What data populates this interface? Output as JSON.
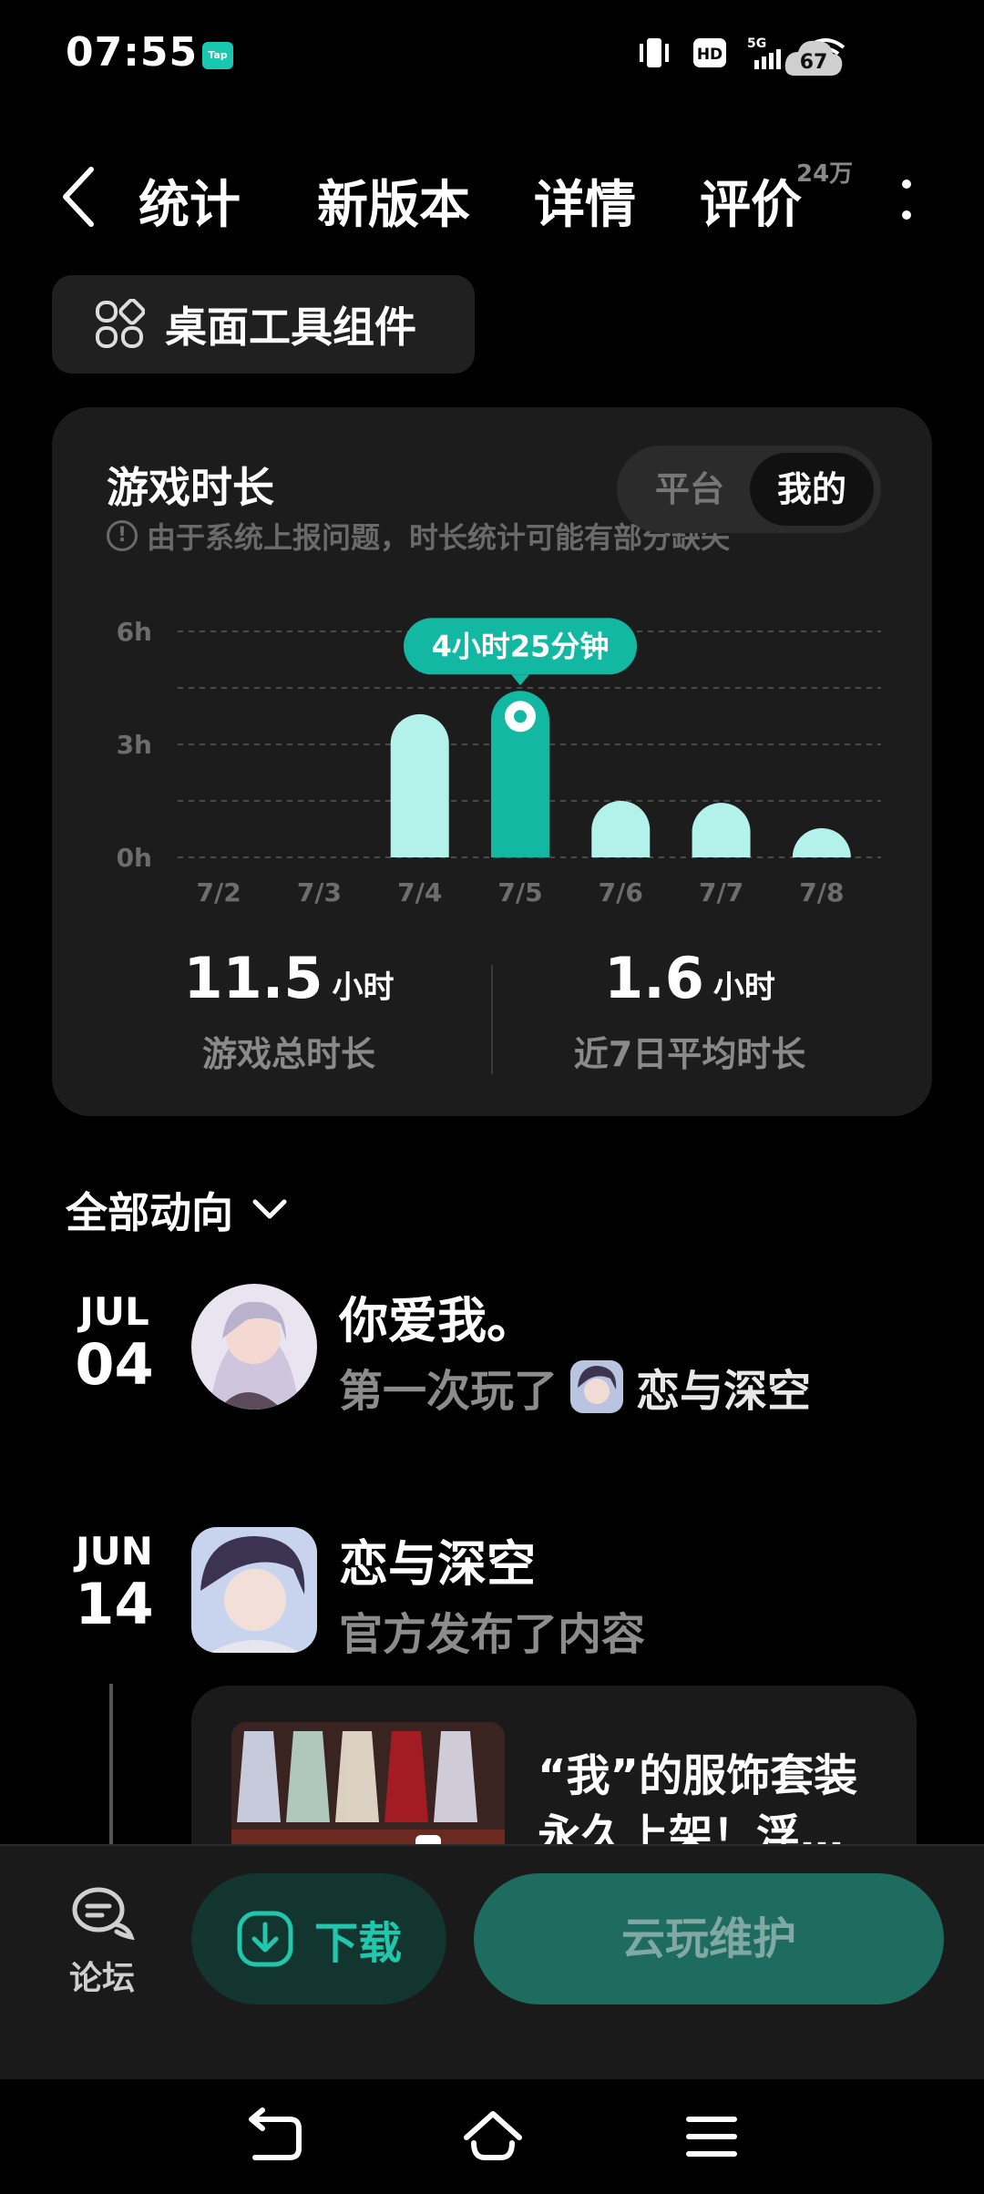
{
  "status_bar": {
    "time": "07:55",
    "app_badge": "Tap",
    "battery": "67",
    "network": "5G"
  },
  "nav": {
    "tabs": [
      {
        "label": "统计",
        "active": true
      },
      {
        "label": "新版本",
        "active": false
      },
      {
        "label": "详情",
        "active": false
      },
      {
        "label": "评价",
        "active": false
      }
    ],
    "review_badge": "24万"
  },
  "widget_chip": {
    "label": "桌面工具组件"
  },
  "stats_card": {
    "title": "游戏时长",
    "note": "由于系统上报问题，时长统计可能有部分缺失",
    "segment": {
      "options": [
        "平台",
        "我的"
      ],
      "selected": "我的"
    },
    "tooltip": "4小时25分钟",
    "total": {
      "value": "11.5",
      "unit": "小时",
      "label": "游戏总时长"
    },
    "average": {
      "value": "1.6",
      "unit": "小时",
      "label": "近7日平均时长"
    }
  },
  "chart_data": {
    "type": "bar",
    "categories": [
      "7/2",
      "7/3",
      "7/4",
      "7/5",
      "7/6",
      "7/7",
      "7/8"
    ],
    "values": [
      0,
      0,
      3.8,
      4.42,
      1.5,
      1.45,
      0.4
    ],
    "highlight_index": 3,
    "ylim": [
      0,
      6
    ],
    "yticks": [
      "0h",
      "3h",
      "6h"
    ],
    "grid": true,
    "colors": {
      "bar": "#b3f2ea",
      "highlight": "#13b8a2"
    }
  },
  "activity": {
    "header": "全部动向",
    "items": [
      {
        "month": "JUL",
        "day": "04",
        "title": "你爱我。",
        "sub_prefix": "第一次玩了",
        "game": "恋与深空"
      },
      {
        "month": "JUN",
        "day": "14",
        "title": "恋与深空",
        "sub_text": "官方发布了内容"
      }
    ],
    "post": {
      "title": "“我”的服饰套装永久上架！浮…"
    }
  },
  "action_bar": {
    "forum_label": "论坛",
    "download_label": "下载",
    "cloud_label": "云玩维护"
  },
  "colors": {
    "accent": "#13b8a2",
    "card_bg": "#1c1c1c"
  }
}
